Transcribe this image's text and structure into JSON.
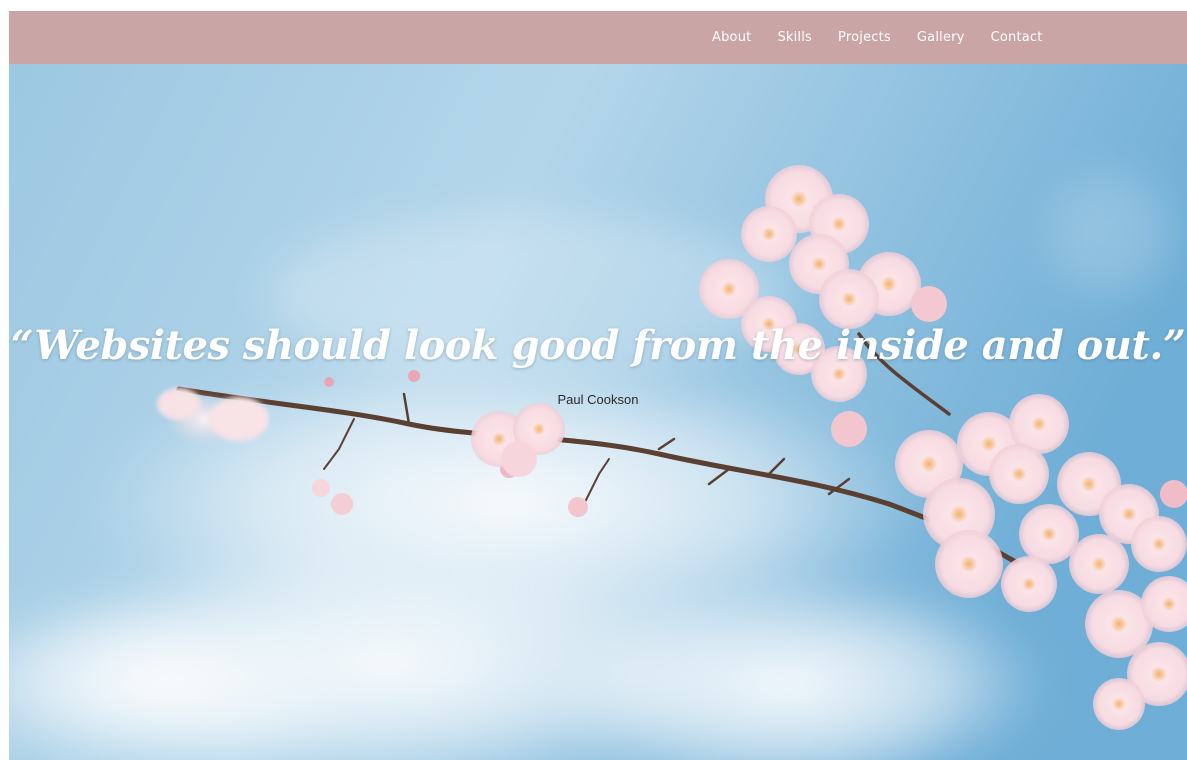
{
  "nav": {
    "background_color": "#c9a5a5",
    "items": [
      {
        "label": "About"
      },
      {
        "label": "Skills"
      },
      {
        "label": "Projects"
      },
      {
        "label": "Gallery"
      },
      {
        "label": "Contact"
      }
    ]
  },
  "hero": {
    "quote": "“Websites should look good from the inside and out.”",
    "author": "Paul Cookson",
    "sky_color": "#86bfe0",
    "blossom_color": "#f6dde3"
  }
}
